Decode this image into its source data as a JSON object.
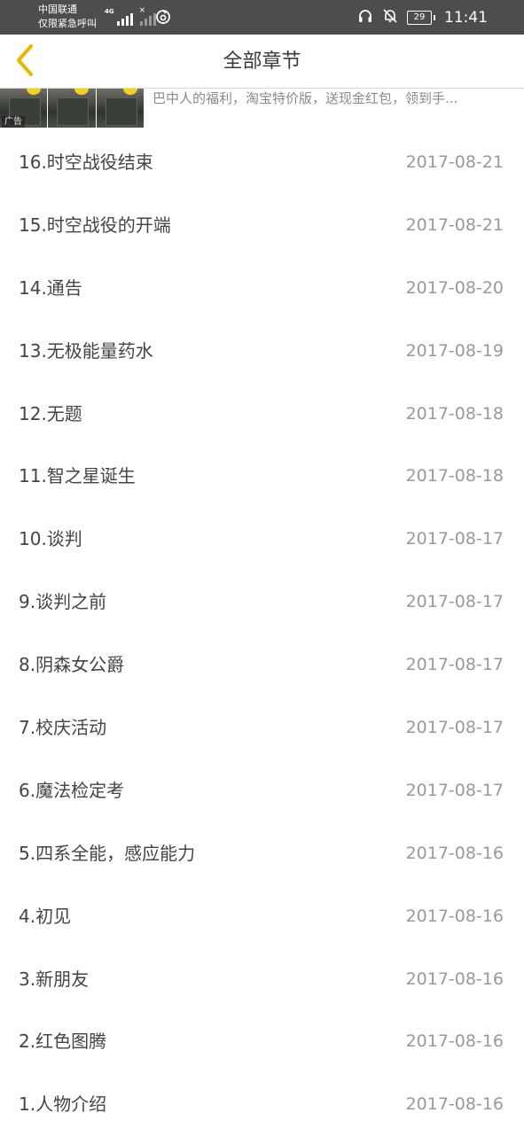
{
  "status_bar": {
    "carrier_line1": "中国联通",
    "carrier_line2": "仅限紧急呼叫",
    "network_type": "4G",
    "battery_level": "29",
    "time": "11:41"
  },
  "header": {
    "title": "全部章节"
  },
  "ad": {
    "badge": "广告",
    "text": "巴中人的福利，淘宝特价版，送现金红包，领到手..."
  },
  "chapters": [
    {
      "title": "16.时空战役结束",
      "date": "2017-08-21"
    },
    {
      "title": "15.时空战役的开端",
      "date": "2017-08-21"
    },
    {
      "title": "14.通告",
      "date": "2017-08-20"
    },
    {
      "title": "13.无极能量药水",
      "date": "2017-08-19"
    },
    {
      "title": "12.无题",
      "date": "2017-08-18"
    },
    {
      "title": "11.智之星诞生",
      "date": "2017-08-18"
    },
    {
      "title": "10.谈判",
      "date": "2017-08-17"
    },
    {
      "title": "9.谈判之前",
      "date": "2017-08-17"
    },
    {
      "title": "8.阴森女公爵",
      "date": "2017-08-17"
    },
    {
      "title": "7.校庆活动",
      "date": "2017-08-17"
    },
    {
      "title": "6.魔法检定考",
      "date": "2017-08-17"
    },
    {
      "title": "5.四系全能，感应能力",
      "date": "2017-08-16"
    },
    {
      "title": "4.初见",
      "date": "2017-08-16"
    },
    {
      "title": "3.新朋友",
      "date": "2017-08-16"
    },
    {
      "title": "2.红色图腾",
      "date": "2017-08-16"
    },
    {
      "title": "1.人物介绍",
      "date": "2017-08-16"
    }
  ],
  "colors": {
    "accent": "#e8b800",
    "status_bar_bg": "#4d4d4d",
    "title_text": "#444444",
    "date_text": "#999999"
  },
  "icons": {
    "back": "chevron-left-icon",
    "headset": "headset-icon",
    "mute": "bell-off-icon",
    "hotspot": "hotspot-icon"
  }
}
